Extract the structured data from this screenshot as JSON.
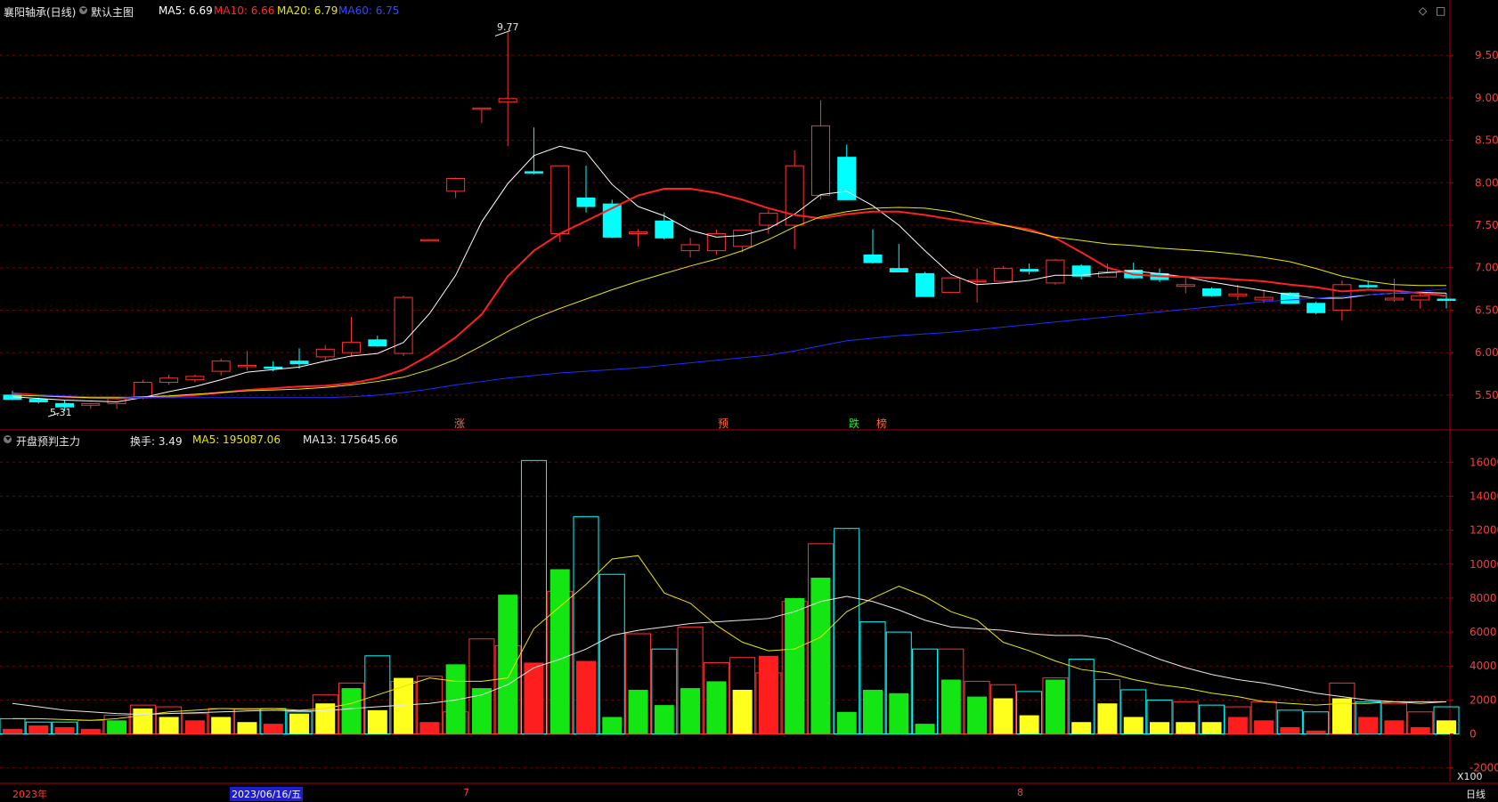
{
  "header": {
    "stock_title": "襄阳轴承(日线)",
    "main_chart_label": "默认主图",
    "ma5": "MA5: 6.69",
    "ma10": "MA10: 6.66",
    "ma20": "MA20: 6.79",
    "ma60": "MA60: 6.75",
    "win_icons": [
      "◇",
      "□"
    ]
  },
  "indicator": {
    "name": "开盘预判主力",
    "turnover": "换手: 3.49",
    "ma5": "MA5: 195087.06",
    "ma13": "MA13: 175645.66"
  },
  "price_axis": {
    "ticks": [
      "9.50",
      "9.00",
      "8.50",
      "8.00",
      "7.50",
      "7.00",
      "6.50",
      "6.00",
      "5.50"
    ],
    "ylim": [
      5.1,
      9.9
    ]
  },
  "volume_axis": {
    "ticks": [
      "16000",
      "14000",
      "12000",
      "10000",
      "8000",
      "6000",
      "4000",
      "2000",
      "0",
      "-2000"
    ],
    "ylim": [
      -2800,
      16800
    ],
    "multiplier": "X100"
  },
  "annotations": {
    "high": "9.77",
    "low": "5.31",
    "events": [
      "涨",
      "预",
      "跌",
      "榜"
    ]
  },
  "time_axis": {
    "labels": [
      "2023年",
      "2023/06/16/五",
      "7",
      "8"
    ],
    "period": "日线"
  },
  "colors": {
    "up": "#ff3232",
    "down": "#00ffff",
    "ma5": "#ffffff",
    "ma10": "#ff2020",
    "ma20": "#e8e800",
    "ma60": "#1f2fff",
    "grid": "#7a0000",
    "axis_text": "#ff3b3b"
  },
  "chart_data": [
    {
      "type": "candlestick",
      "series": [
        {
          "name": "candles",
          "ohlc": [
            [
              5.5,
              5.55,
              5.44,
              5.45
            ],
            [
              5.45,
              5.47,
              5.4,
              5.42
            ],
            [
              5.4,
              5.44,
              5.31,
              5.36
            ],
            [
              5.38,
              5.41,
              5.34,
              5.4
            ],
            [
              5.4,
              5.48,
              5.34,
              5.47
            ],
            [
              5.47,
              5.68,
              5.45,
              5.65
            ],
            [
              5.65,
              5.74,
              5.62,
              5.7
            ],
            [
              5.68,
              5.74,
              5.65,
              5.72
            ],
            [
              5.78,
              5.93,
              5.73,
              5.9
            ],
            [
              5.84,
              6.02,
              5.79,
              5.85
            ],
            [
              5.83,
              5.9,
              5.78,
              5.82
            ],
            [
              5.9,
              6.05,
              5.81,
              5.87
            ],
            [
              5.95,
              6.09,
              5.9,
              6.04
            ],
            [
              6.0,
              6.42,
              5.95,
              6.12
            ],
            [
              6.15,
              6.2,
              6.07,
              6.08
            ],
            [
              5.99,
              6.67,
              5.96,
              6.65
            ],
            [
              7.33,
              7.33,
              7.33,
              7.33
            ],
            [
              7.9,
              8.06,
              7.82,
              8.05
            ],
            [
              8.88,
              8.88,
              8.7,
              8.88
            ],
            [
              8.95,
              9.77,
              8.43,
              8.99
            ],
            [
              8.13,
              8.65,
              8.1,
              8.12
            ],
            [
              7.4,
              8.2,
              7.3,
              8.2
            ],
            [
              7.82,
              8.2,
              7.65,
              7.72
            ],
            [
              7.75,
              7.8,
              7.35,
              7.36
            ],
            [
              7.4,
              7.45,
              7.25,
              7.42
            ],
            [
              7.55,
              7.65,
              7.33,
              7.35
            ],
            [
              7.2,
              7.35,
              7.12,
              7.27
            ],
            [
              7.2,
              7.45,
              7.15,
              7.4
            ],
            [
              7.25,
              7.45,
              7.18,
              7.44
            ],
            [
              7.5,
              7.68,
              7.4,
              7.64
            ],
            [
              7.5,
              8.38,
              7.22,
              8.2
            ],
            [
              7.85,
              8.97,
              7.8,
              8.67
            ],
            [
              8.3,
              8.45,
              7.8,
              7.8
            ],
            [
              7.15,
              7.45,
              7.05,
              7.06
            ],
            [
              6.99,
              7.28,
              6.95,
              6.95
            ],
            [
              6.93,
              6.95,
              6.66,
              6.66
            ],
            [
              6.71,
              6.89,
              6.71,
              6.88
            ],
            [
              6.84,
              6.99,
              6.59,
              6.85
            ],
            [
              6.84,
              7.02,
              6.84,
              6.99
            ],
            [
              6.98,
              7.05,
              6.92,
              6.96
            ],
            [
              6.82,
              7.1,
              6.8,
              7.09
            ],
            [
              7.02,
              7.04,
              6.86,
              6.9
            ],
            [
              6.89,
              7.05,
              6.88,
              6.95
            ],
            [
              6.97,
              7.06,
              6.87,
              6.88
            ],
            [
              6.93,
              6.99,
              6.83,
              6.86
            ],
            [
              6.78,
              6.9,
              6.7,
              6.8
            ],
            [
              6.75,
              6.77,
              6.66,
              6.67
            ],
            [
              6.67,
              6.8,
              6.62,
              6.69
            ],
            [
              6.62,
              6.74,
              6.58,
              6.65
            ],
            [
              6.7,
              6.71,
              6.58,
              6.58
            ],
            [
              6.58,
              6.6,
              6.45,
              6.47
            ],
            [
              6.5,
              6.85,
              6.38,
              6.8
            ],
            [
              6.79,
              6.85,
              6.76,
              6.78
            ],
            [
              6.62,
              6.87,
              6.6,
              6.64
            ],
            [
              6.62,
              6.72,
              6.52,
              6.67
            ],
            [
              6.63,
              6.7,
              6.52,
              6.62
            ]
          ]
        },
        {
          "name": "MA5",
          "values": [
            5.48,
            5.46,
            5.44,
            5.43,
            5.42,
            5.47,
            5.54,
            5.6,
            5.68,
            5.77,
            5.8,
            5.83,
            5.9,
            5.96,
            5.99,
            6.12,
            6.46,
            6.91,
            7.54,
            7.99,
            8.32,
            8.43,
            8.36,
            7.98,
            7.72,
            7.61,
            7.44,
            7.36,
            7.38,
            7.46,
            7.63,
            7.86,
            7.9,
            7.73,
            7.5,
            7.2,
            6.92,
            6.8,
            6.82,
            6.85,
            6.91,
            6.91,
            6.94,
            6.96,
            6.93,
            6.89,
            6.83,
            6.78,
            6.73,
            6.68,
            6.64,
            6.64,
            6.68,
            6.7,
            6.71,
            6.7
          ]
        },
        {
          "name": "MA10",
          "values": [
            5.52,
            5.5,
            5.48,
            5.47,
            5.46,
            5.47,
            5.48,
            5.5,
            5.53,
            5.56,
            5.58,
            5.6,
            5.61,
            5.64,
            5.7,
            5.8,
            5.97,
            6.18,
            6.45,
            6.9,
            7.2,
            7.4,
            7.55,
            7.7,
            7.85,
            7.93,
            7.93,
            7.88,
            7.8,
            7.7,
            7.62,
            7.58,
            7.63,
            7.66,
            7.66,
            7.62,
            7.57,
            7.53,
            7.5,
            7.45,
            7.35,
            7.18,
            7.0,
            6.92,
            6.9,
            6.89,
            6.88,
            6.86,
            6.84,
            6.8,
            6.77,
            6.72,
            6.74,
            6.73,
            6.7,
            6.67
          ]
        },
        {
          "name": "MA20",
          "values": [
            5.5,
            5.49,
            5.48,
            5.47,
            5.47,
            5.48,
            5.49,
            5.51,
            5.53,
            5.55,
            5.56,
            5.57,
            5.59,
            5.62,
            5.66,
            5.71,
            5.8,
            5.92,
            6.08,
            6.25,
            6.4,
            6.52,
            6.63,
            6.74,
            6.84,
            6.93,
            7.02,
            7.1,
            7.2,
            7.33,
            7.48,
            7.6,
            7.66,
            7.7,
            7.71,
            7.7,
            7.66,
            7.58,
            7.5,
            7.43,
            7.36,
            7.32,
            7.28,
            7.26,
            7.23,
            7.21,
            7.19,
            7.16,
            7.12,
            7.07,
            6.99,
            6.9,
            6.84,
            6.8,
            6.79,
            6.79
          ]
        },
        {
          "name": "MA60",
          "values": [
            5.51,
            5.5,
            5.49,
            5.48,
            5.48,
            5.47,
            5.47,
            5.47,
            5.47,
            5.47,
            5.47,
            5.47,
            5.47,
            5.48,
            5.5,
            5.53,
            5.57,
            5.62,
            5.66,
            5.7,
            5.73,
            5.76,
            5.78,
            5.8,
            5.82,
            5.85,
            5.88,
            5.91,
            5.94,
            5.97,
            6.02,
            6.08,
            6.14,
            6.17,
            6.2,
            6.22,
            6.24,
            6.27,
            6.3,
            6.33,
            6.36,
            6.39,
            6.42,
            6.45,
            6.48,
            6.51,
            6.54,
            6.57,
            6.6,
            6.62,
            6.64,
            6.66,
            6.68,
            6.7,
            6.72,
            6.75
          ]
        }
      ]
    },
    {
      "type": "bar",
      "series": [
        {
          "name": "outline",
          "values": [
            900,
            700,
            700,
            800,
            1100,
            1700,
            1600,
            1200,
            1500,
            1500,
            1500,
            1300,
            2300,
            3000,
            4600,
            3100,
            3400,
            1300,
            5600,
            5200,
            16100,
            8400,
            12800,
            9400,
            5900,
            5000,
            6300,
            4200,
            4500,
            3600,
            7800,
            11200,
            12100,
            6600,
            6000,
            5000,
            5000,
            3100,
            2900,
            2500,
            3300,
            4400,
            3200,
            2600,
            2000,
            1900,
            1700,
            1600,
            1900,
            1400,
            1300,
            3000,
            1900,
            1800,
            1300,
            1600
          ]
        },
        {
          "name": "main-force",
          "values": [
            300,
            500,
            400,
            300,
            800,
            1500,
            1000,
            800,
            1000,
            700,
            600,
            1200,
            1800,
            2700,
            1400,
            3300,
            700,
            4100,
            2700,
            8200,
            4200,
            9700,
            4300,
            1000,
            2600,
            1700,
            2700,
            3100,
            2600,
            4600,
            8000,
            9200,
            1300,
            2600,
            2400,
            600,
            3200,
            2200,
            2100,
            1100,
            3200,
            700,
            1800,
            1000,
            700,
            700,
            700,
            1000,
            800,
            400,
            200,
            2100,
            1000,
            800,
            400,
            800
          ]
        },
        {
          "name": "main-force-colors",
          "values": [
            0,
            0,
            0,
            0,
            1,
            2,
            2,
            0,
            2,
            2,
            0,
            2,
            2,
            1,
            2,
            2,
            0,
            1,
            1,
            1,
            0,
            1,
            0,
            1,
            1,
            1,
            1,
            1,
            2,
            0,
            1,
            1,
            1,
            1,
            1,
            1,
            1,
            1,
            2,
            2,
            1,
            2,
            2,
            2,
            2,
            2,
            2,
            0,
            0,
            0,
            0,
            2,
            0,
            0,
            0,
            2
          ]
        },
        {
          "name": "MA5",
          "values": [
            900,
            900,
            850,
            800,
            900,
            1100,
            1300,
            1400,
            1500,
            1450,
            1500,
            1400,
            1500,
            1800,
            2300,
            2800,
            3300,
            3100,
            3100,
            3300,
            6200,
            7500,
            8800,
            10300,
            10500,
            8300,
            7700,
            6400,
            5400,
            4900,
            5000,
            5700,
            7200,
            8000,
            8700,
            8100,
            7200,
            6700,
            5400,
            4900,
            4300,
            3800,
            3600,
            3200,
            2900,
            2700,
            2400,
            2200,
            1900,
            1800,
            1700,
            1800,
            1800,
            1900,
            1800,
            1900
          ]
        },
        {
          "name": "MA13",
          "values": [
            1800,
            1600,
            1400,
            1300,
            1200,
            1150,
            1200,
            1250,
            1300,
            1350,
            1400,
            1350,
            1350,
            1500,
            1600,
            1700,
            1800,
            2000,
            2300,
            2900,
            3900,
            4400,
            5000,
            5800,
            6100,
            6300,
            6500,
            6600,
            6700,
            6800,
            7200,
            7800,
            8100,
            7800,
            7300,
            6700,
            6300,
            6200,
            6100,
            5900,
            5800,
            5800,
            5600,
            5000,
            4400,
            3900,
            3500,
            3200,
            3000,
            2700,
            2400,
            2200,
            2000,
            1900,
            1900,
            1900
          ]
        }
      ]
    }
  ]
}
